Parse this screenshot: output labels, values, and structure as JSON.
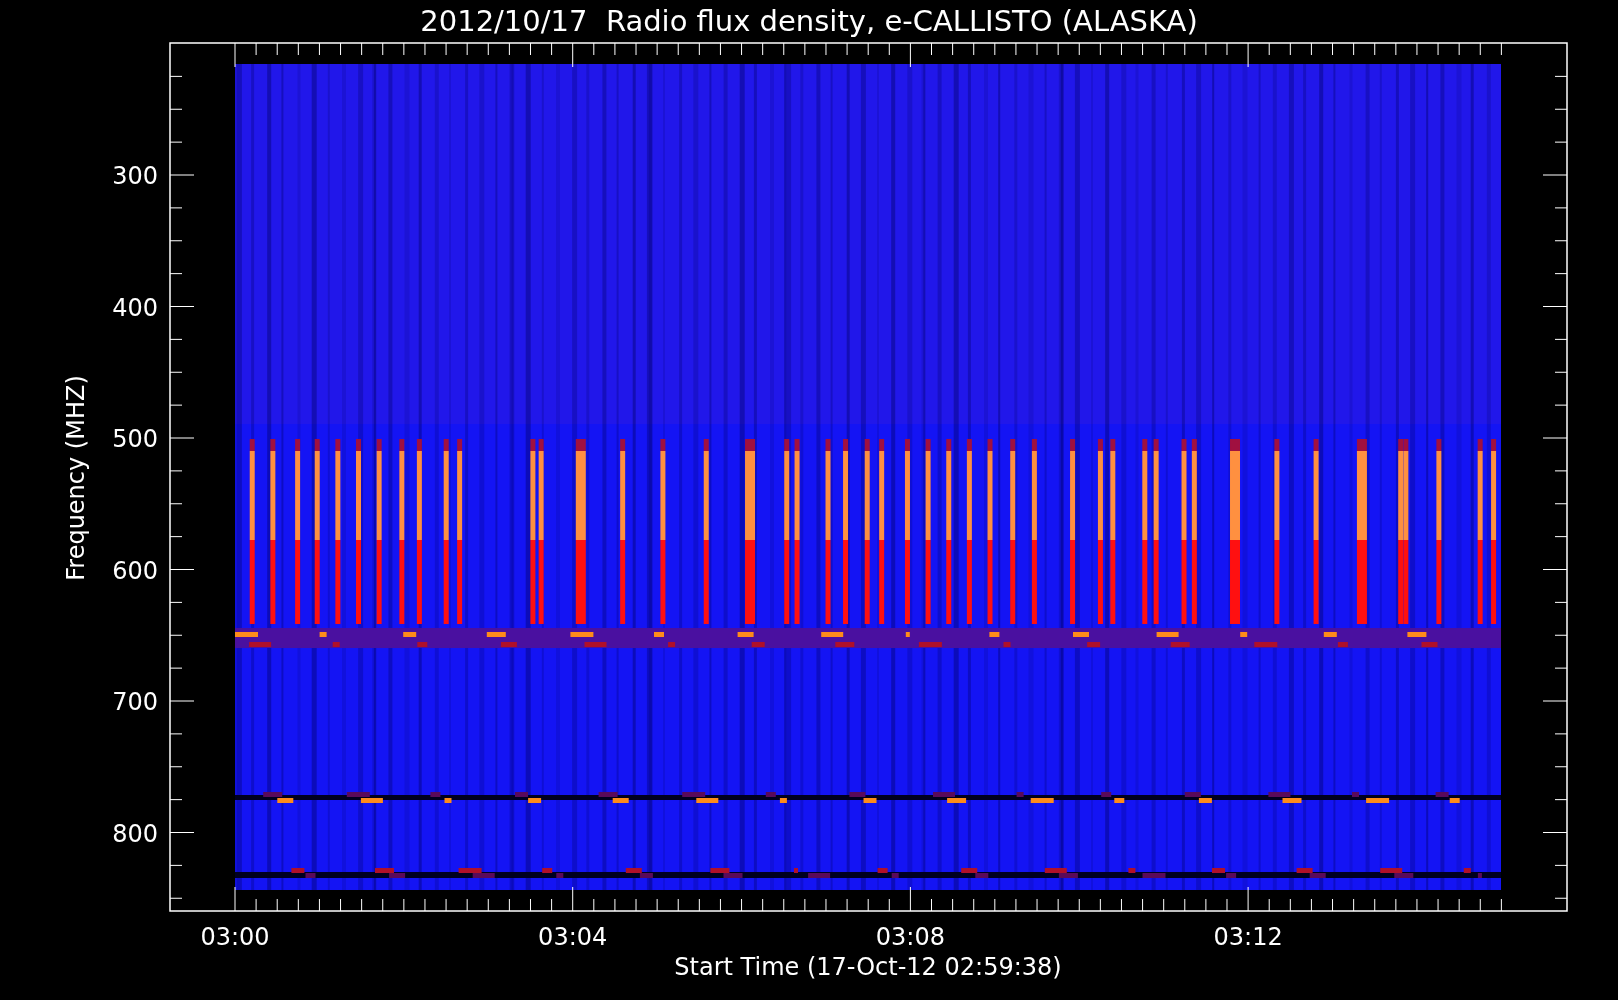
{
  "title": "2012/10/17  Radio flux density, e-CALLISTO (ALASKA)",
  "x_axis": {
    "label": "Start Time (17-Oct-12 02:59:38)",
    "ticks": [
      "03:00",
      "03:04",
      "03:08",
      "03:12"
    ]
  },
  "y_axis": {
    "label": "Frequency (MHZ)",
    "ticks": [
      "300",
      "400",
      "500",
      "600",
      "700",
      "800"
    ]
  }
}
